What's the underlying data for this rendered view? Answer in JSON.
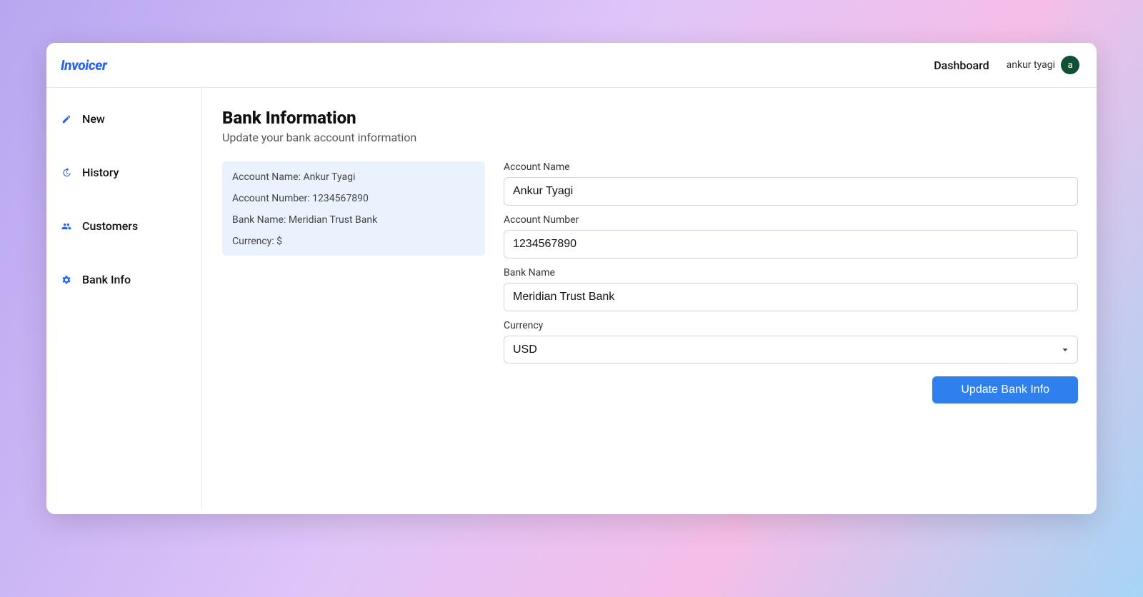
{
  "header": {
    "logo": "Invoicer",
    "nav_dashboard": "Dashboard",
    "user_name": "ankur tyagi",
    "avatar_initial": "a"
  },
  "sidebar": {
    "items": [
      {
        "label": "New"
      },
      {
        "label": "History"
      },
      {
        "label": "Customers"
      },
      {
        "label": "Bank Info"
      }
    ]
  },
  "main": {
    "title": "Bank Information",
    "subtitle": "Update your bank account information"
  },
  "summary": {
    "account_name_label": "Account Name:",
    "account_name_value": "Ankur Tyagi",
    "account_number_label": "Account Number:",
    "account_number_value": "1234567890",
    "bank_name_label": "Bank Name:",
    "bank_name_value": "Meridian Trust Bank",
    "currency_label": "Currency:",
    "currency_value": "$"
  },
  "form": {
    "account_name_label": "Account Name",
    "account_name_value": "Ankur Tyagi",
    "account_number_label": "Account Number",
    "account_number_value": "1234567890",
    "bank_name_label": "Bank Name",
    "bank_name_value": "Meridian Trust Bank",
    "currency_label": "Currency",
    "currency_value": "USD",
    "submit_label": "Update Bank Info"
  }
}
